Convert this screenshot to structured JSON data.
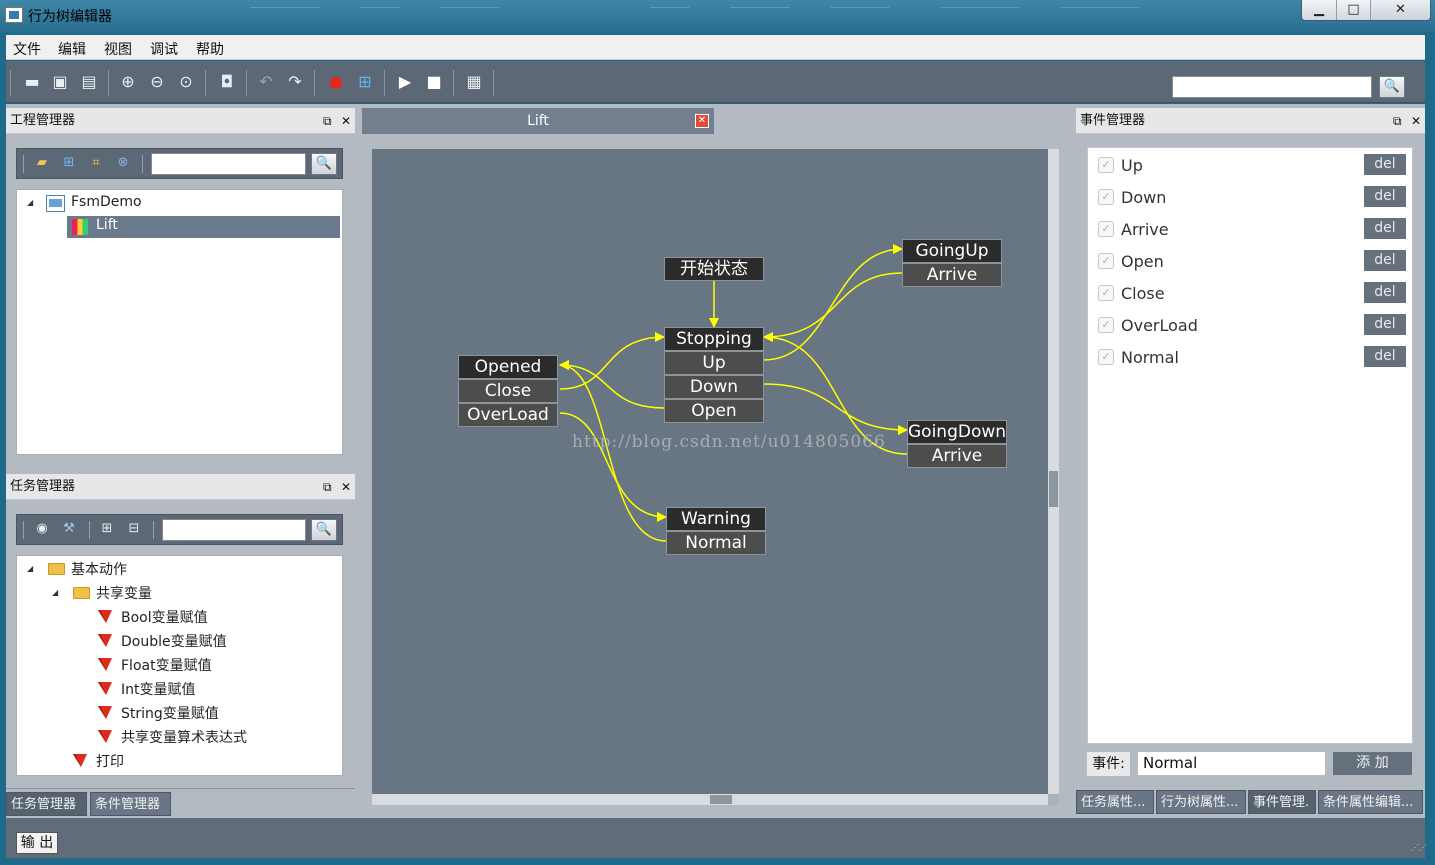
{
  "window": {
    "title": "行为树编辑器"
  },
  "menubar": {
    "items": [
      "文件",
      "编辑",
      "视图",
      "调试",
      "帮助"
    ]
  },
  "toolbar": {
    "search_value": ""
  },
  "project_panel": {
    "title": "工程管理器",
    "search_value": "",
    "tree": {
      "root": "FsmDemo",
      "child": "Lift"
    }
  },
  "task_panel": {
    "title": "任务管理器",
    "search_value": "",
    "tree": {
      "group": "基本动作",
      "subgroup": "共享变量",
      "leaves": [
        "Bool变量赋值",
        "Double变量赋值",
        "Float变量赋值",
        "Int变量赋值",
        "String变量赋值",
        "共享变量算术表达式"
      ],
      "extra": "打印"
    }
  },
  "left_tabs": [
    "任务管理器",
    "条件管理器"
  ],
  "document": {
    "tab_label": "Lift"
  },
  "canvas": {
    "watermark": "http://blog.csdn.net/u014805066",
    "nodes": {
      "start": [
        "开始状态"
      ],
      "stopping": [
        "Stopping",
        "Up",
        "Down",
        "Open"
      ],
      "goingup": [
        "GoingUp",
        "Arrive"
      ],
      "goingdown": [
        "GoingDown",
        "Arrive"
      ],
      "opened": [
        "Opened",
        "Close",
        "OverLoad"
      ],
      "warning": [
        "Warning",
        "Normal"
      ]
    },
    "edge_color": "#ffff00"
  },
  "event_panel": {
    "title": "事件管理器",
    "events": [
      "Up",
      "Down",
      "Arrive",
      "Open",
      "Close",
      "OverLoad",
      "Normal"
    ],
    "del_label": "del",
    "event_label": "事件:",
    "event_value": "Normal",
    "add_label": "添 加"
  },
  "right_tabs": [
    "任务属性...",
    "行为树属性...",
    "事件管理.",
    "条件属性编辑..."
  ],
  "statusbar": {
    "output_label": "输 出"
  }
}
